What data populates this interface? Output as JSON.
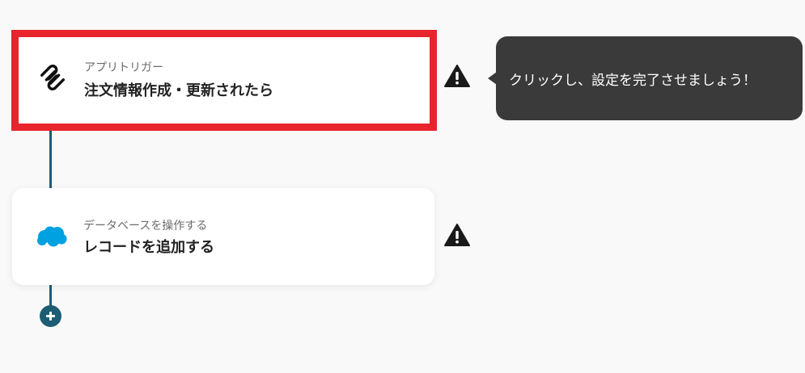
{
  "flow": {
    "steps": [
      {
        "kind": "アプリトリガー",
        "title": "注文情報作成・更新されたら",
        "icon": "squarespace-logo-icon",
        "highlighted": true,
        "warning_icon": "warning-triangle-icon"
      },
      {
        "kind": "データベースを操作する",
        "title": "レコードを追加する",
        "icon": "salesforce-cloud-icon",
        "highlighted": false,
        "warning_icon": "warning-triangle-icon"
      }
    ],
    "add_step_icon": "plus-circle-icon"
  },
  "tooltip": {
    "text": "クリックし、設定を完了させましょう！"
  },
  "colors": {
    "background": "#f9f9f9",
    "connector": "#1d5d73",
    "highlight_border": "#e8242c",
    "tooltip_bg": "#3a3a3a",
    "salesforce_blue": "#00a1e0",
    "warning": "#1a1a1a"
  }
}
